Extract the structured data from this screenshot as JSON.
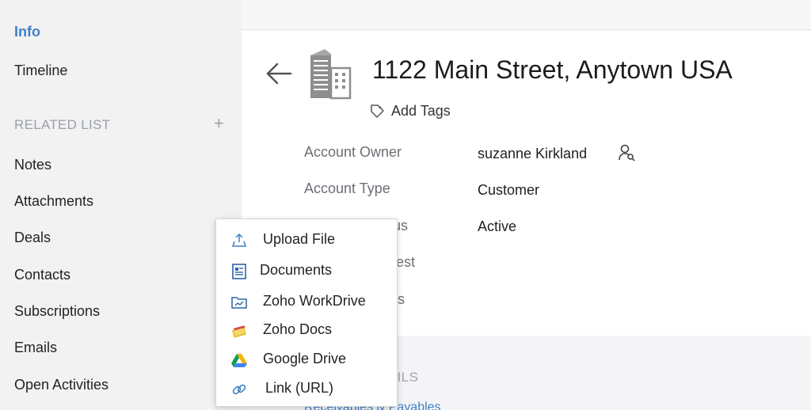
{
  "sidebar": {
    "info": "Info",
    "timeline": "Timeline",
    "related_list": "RELATED LIST",
    "add_symbol": "+",
    "items": [
      "Notes",
      "Attachments",
      "Deals",
      "Contacts",
      "Subscriptions",
      "Emails",
      "Open Activities"
    ]
  },
  "record": {
    "title": "1122 Main Street, Anytown USA",
    "add_tags": "Add Tags"
  },
  "fields": [
    {
      "label": "Account Owner",
      "value": "suzanne Kirkland"
    },
    {
      "label": "Account Type",
      "value": "Customer"
    },
    {
      "label": "us",
      "value": "Active"
    },
    {
      "label": "est",
      "value": ""
    },
    {
      "label": "s",
      "value": ""
    }
  ],
  "section": {
    "title": "TAILS",
    "link": "Receivables & Payables",
    "chevron": "⌄"
  },
  "dropdown": {
    "items": [
      {
        "label": "Upload File",
        "icon": "upload-icon"
      },
      {
        "label": "Documents",
        "icon": "documents-icon"
      },
      {
        "label": "Zoho WorkDrive",
        "icon": "workdrive-icon"
      },
      {
        "label": "Zoho Docs",
        "icon": "zoho-docs-icon"
      },
      {
        "label": "Google Drive",
        "icon": "google-drive-icon"
      },
      {
        "label": "Link (URL)",
        "icon": "link-icon"
      }
    ]
  },
  "colors": {
    "accent": "#3f80c8",
    "muted": "#9aa0a8"
  }
}
